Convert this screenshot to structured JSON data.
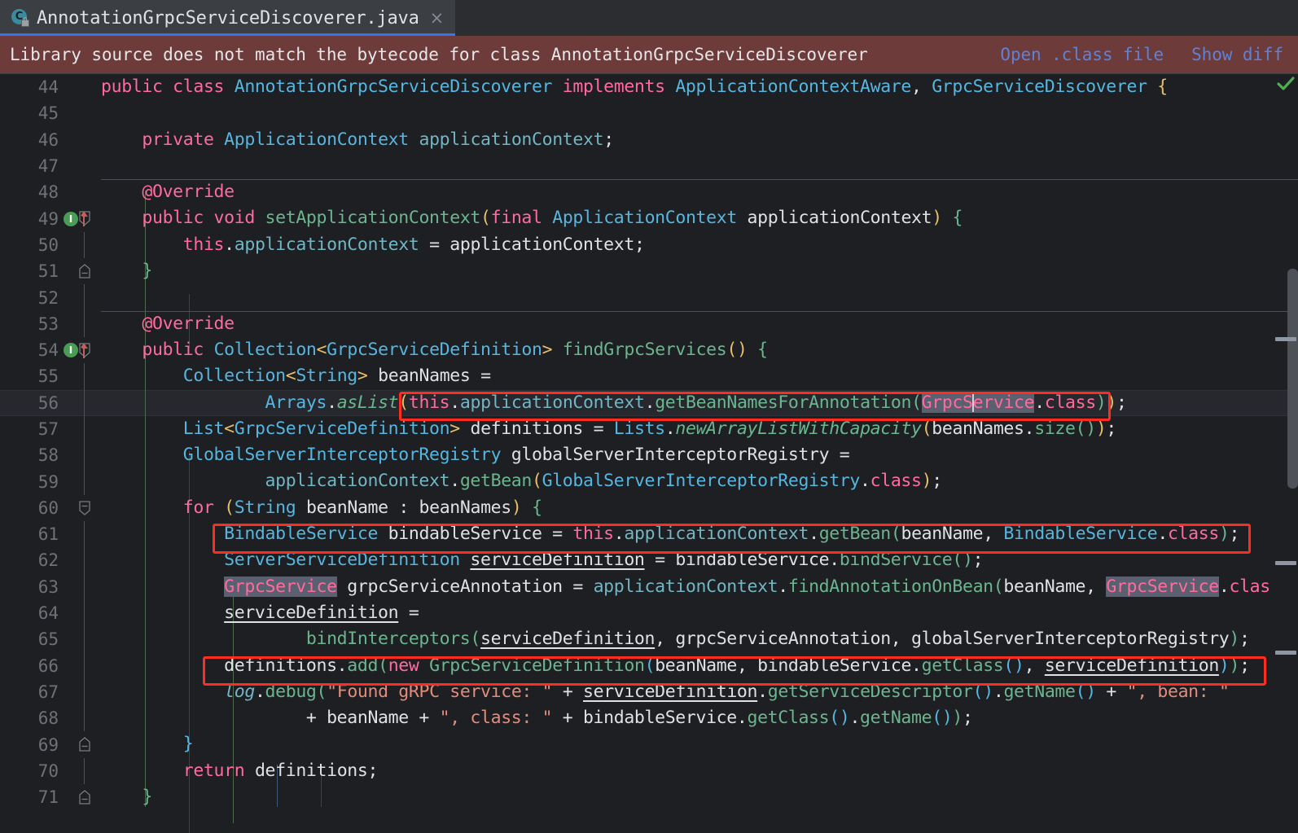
{
  "window": {
    "title": "AnnotationGrpcServiceDiscoverer.java"
  },
  "tab": {
    "filename": "AnnotationGrpcServiceDiscoverer.java",
    "icon": "java-class-readonly-icon",
    "close_label": "×"
  },
  "notification": {
    "message": "Library source does not match the bytecode for class AnnotationGrpcServiceDiscoverer",
    "links": [
      {
        "label": "Open .class file",
        "name": "open-class-file-link"
      },
      {
        "label": "Show diff",
        "name": "show-diff-link"
      }
    ],
    "background": "#6e3b3b",
    "link_color": "#5e82d6"
  },
  "editor": {
    "first_line": 44,
    "last_line": 71,
    "current_line": 56,
    "marker_label": "I",
    "inspection_status": "ok-check",
    "line_numbers": [
      "44",
      "45",
      "46",
      "47",
      "48",
      "49",
      "50",
      "51",
      "52",
      "53",
      "54",
      "55",
      "56",
      "57",
      "58",
      "59",
      "60",
      "61",
      "62",
      "63",
      "64",
      "65",
      "66",
      "67",
      "68",
      "69",
      "70",
      "71"
    ],
    "code_lines": {
      "l44": "public class AnnotationGrpcServiceDiscoverer implements ApplicationContextAware, GrpcServiceDiscoverer {",
      "l45": "",
      "l46": "    private ApplicationContext applicationContext;",
      "l47": "",
      "l48": "    @Override",
      "l49": "    public void setApplicationContext(final ApplicationContext applicationContext) {",
      "l50": "        this.applicationContext = applicationContext;",
      "l51": "    }",
      "l52": "",
      "l53": "    @Override",
      "l54": "    public Collection<GrpcServiceDefinition> findGrpcServices() {",
      "l55": "        Collection<String> beanNames =",
      "l56": "                Arrays.asList(this.applicationContext.getBeanNamesForAnnotation(GrpcService.class));",
      "l57": "        List<GrpcServiceDefinition> definitions = Lists.newArrayListWithCapacity(beanNames.size());",
      "l58": "        GlobalServerInterceptorRegistry globalServerInterceptorRegistry =",
      "l59": "                applicationContext.getBean(GlobalServerInterceptorRegistry.class);",
      "l60": "        for (String beanName : beanNames) {",
      "l61": "            BindableService bindableService = this.applicationContext.getBean(beanName, BindableService.class);",
      "l62": "            ServerServiceDefinition serviceDefinition = bindableService.bindService();",
      "l63": "            GrpcService grpcServiceAnnotation = applicationContext.findAnnotationOnBean(beanName, GrpcService.class",
      "l64": "            serviceDefinition =",
      "l65": "                    bindInterceptors(serviceDefinition, grpcServiceAnnotation, globalServerInterceptorRegistry);",
      "l66": "            definitions.add(new GrpcServiceDefinition(beanName, bindableService.getClass(), serviceDefinition));",
      "l67": "            log.debug(\"Found gRPC service: \" + serviceDefinition.getServiceDescriptor().getName() + \", bean: \"",
      "l68": "                    + beanName + \", class: \" + bindableService.getClass().getName());",
      "l69": "        }",
      "l70": "        return definitions;",
      "l71": "    }"
    },
    "selection_token": "GrpcService",
    "highlight_color": "#ff2d20",
    "annotations": [
      {
        "name": "highlight-box-line-56",
        "target_line": 56,
        "text": "this.applicationContext.getBeanNamesForAnnotation(GrpcService.class)"
      },
      {
        "name": "highlight-box-line-61",
        "target_line": 61,
        "text": "BindableService bindableService = this.applicationContext.getBean(beanName, BindableService.class);"
      },
      {
        "name": "highlight-box-line-66",
        "target_line": 66,
        "text": "definitions.add(new GrpcServiceDefinition(beanName, bindableService.getClass(), serviceDefinition));"
      }
    ]
  },
  "colors": {
    "editor_background": "#1e1f22",
    "tab_background": "#3b3f43",
    "tabbar_background": "#2b2d30",
    "active_tab_underline": "#3574f0",
    "gutter_text": "#6e7176",
    "implementation_marker": "#499c54",
    "status_ok": "#499c54"
  }
}
